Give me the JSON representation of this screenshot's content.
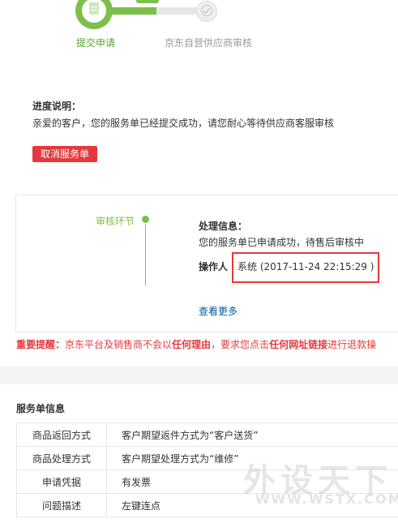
{
  "stepper": {
    "steps": [
      {
        "label": "提交申请",
        "state": "active"
      },
      {
        "label": "京东自营供应商审核",
        "state": "pending"
      }
    ],
    "active_color": "#7cc04b"
  },
  "progress": {
    "title": "进度说明：",
    "text": "亲爱的客户，您的服务单已经提交成功，请您耐心等待供应商客服审核"
  },
  "cancel_button": {
    "label": "取消服务单"
  },
  "review": {
    "node_label": "审核环节",
    "info_title": "处理信息：",
    "info_text": "您的服务单已申请成功，待售后审核中",
    "operator_label": "操作人",
    "operator_value": "系统 (2017-11-24 22:15:29 )",
    "more_link": "查看更多"
  },
  "warning": {
    "prefix": "重要提醒：",
    "part1": "京东平台及销售商不会以",
    "bold1": "任何理由",
    "part2": "，要求您点击",
    "bold2": "任何网址链接",
    "part3": "进行退款操"
  },
  "service_info": {
    "title": "服务单信息",
    "rows": [
      {
        "key": "商品返回方式",
        "value": "客户期望返件方式为“客户送货”"
      },
      {
        "key": "商品处理方式",
        "value": "客户期望处理方式为“维修”"
      },
      {
        "key": "申请凭据",
        "value": "有发票"
      },
      {
        "key": "问题描述",
        "value": "左键连点"
      }
    ]
  },
  "watermark": {
    "text": "外设天下",
    "url": "WWW.WSTX.COM"
  },
  "colors": {
    "accent_red": "#e4393c",
    "link_blue": "#005aa0",
    "green": "#7cc04b"
  }
}
